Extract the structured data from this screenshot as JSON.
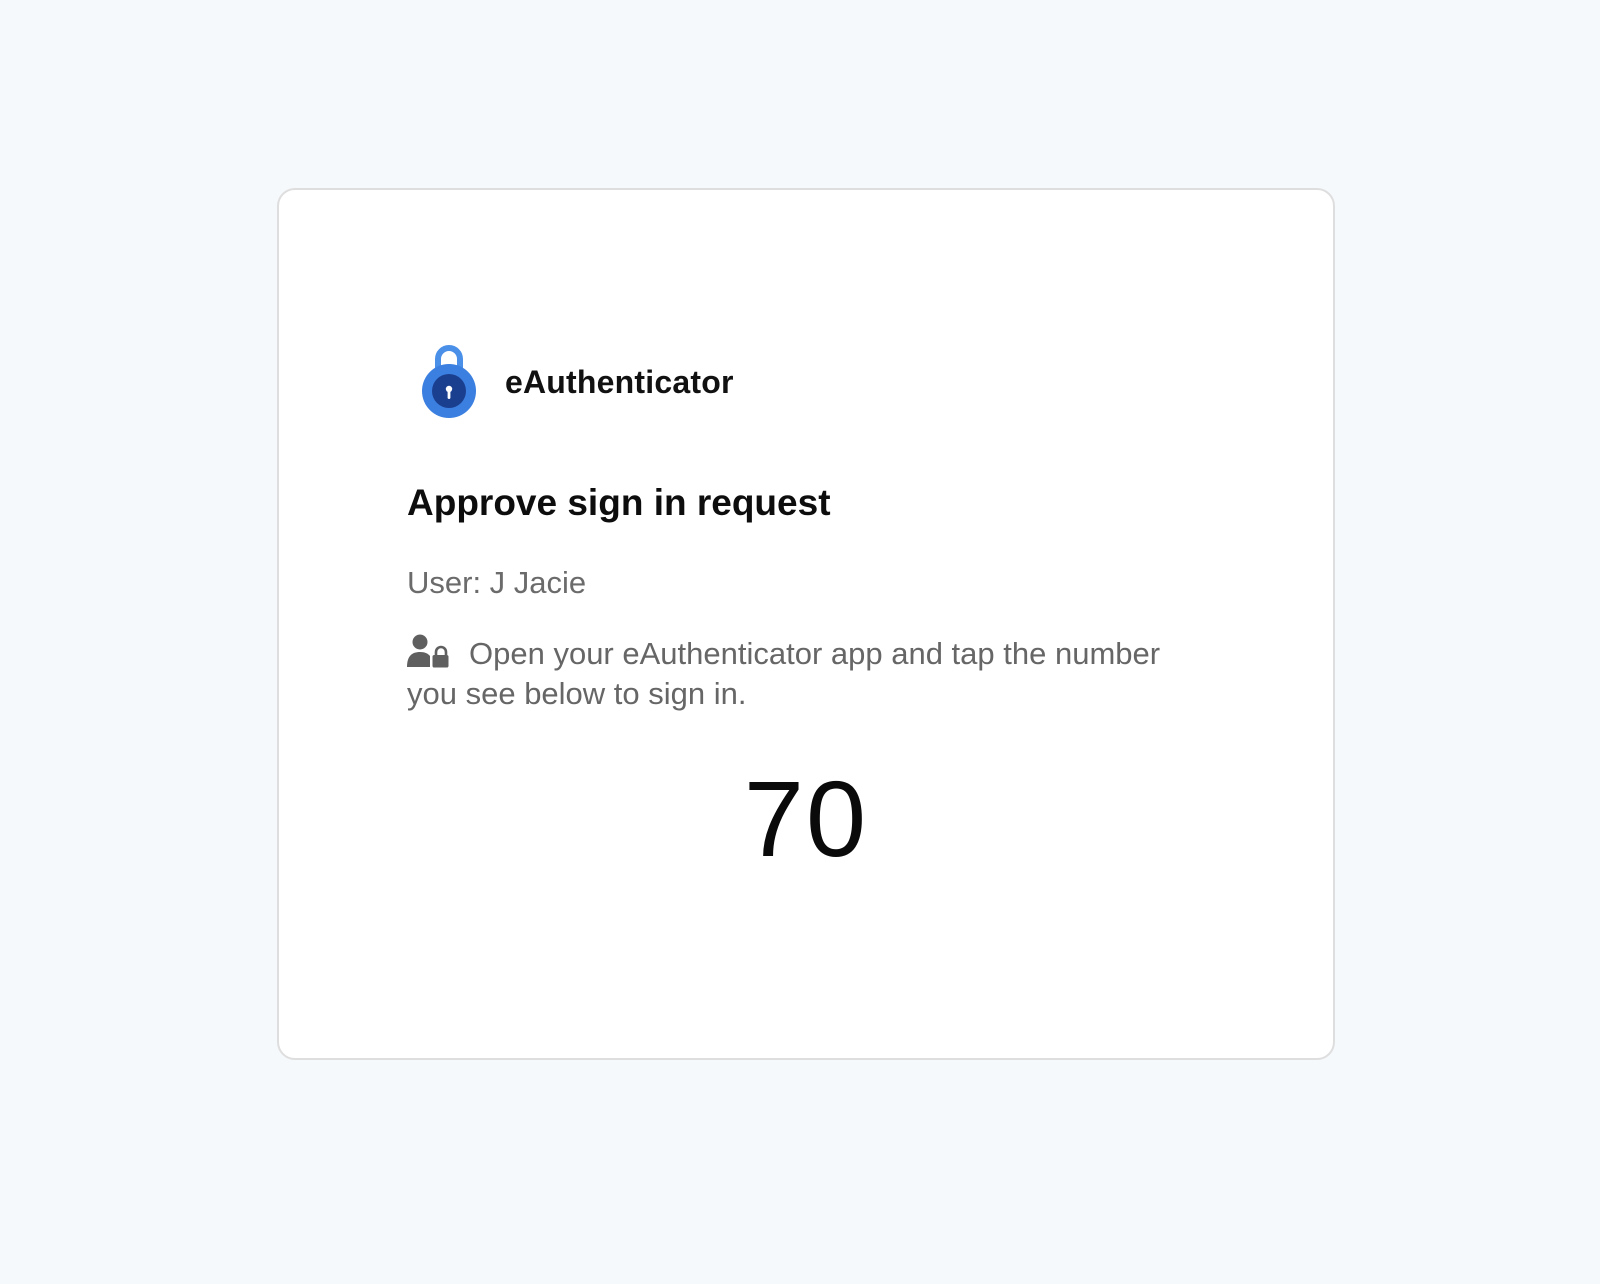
{
  "app": {
    "name": "eAuthenticator",
    "logo_icon": "padlock-logo-icon",
    "logo_colors": {
      "shackle": "#4a8fe8",
      "body_outer": "#3b7fe0",
      "body_inner": "#1b3f8f",
      "keyhole": "#ffffff"
    }
  },
  "request": {
    "title": "Approve sign in request",
    "user_line": "User: J Jacie",
    "instruction_icon": "user-lock-icon",
    "instruction": "Open your eAuthenticator app and tap the number you see below to sign in.",
    "number": "70"
  },
  "colors": {
    "page_background": "#f6f9fc",
    "card_background": "#ffffff",
    "card_border": "#dedede",
    "muted_text": "#666666"
  }
}
